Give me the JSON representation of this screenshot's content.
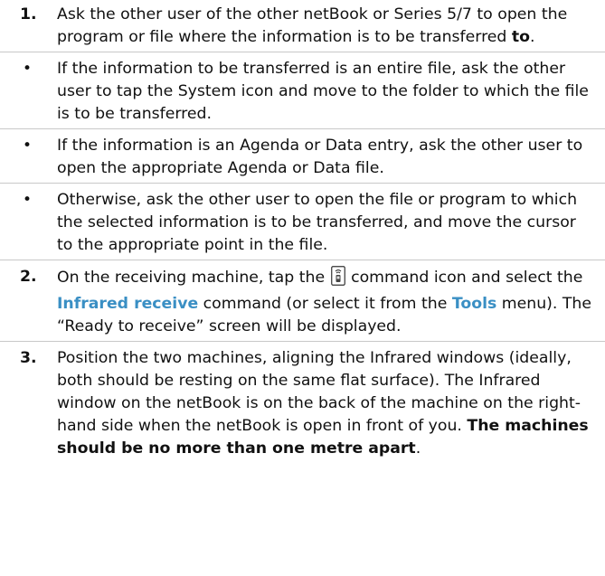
{
  "steps": {
    "step1": {
      "number": "1.",
      "text_a": "Ask the other user of the other netBook or Series 5/7 to open the program or file where the information is to be transferred ",
      "text_b": "to",
      "text_c": "."
    },
    "bullets": [
      {
        "symbol": "•",
        "text": "If the information to be transferred is an entire file, ask the other user to tap the System icon and move to the folder to which the file is to be transferred."
      },
      {
        "symbol": "•",
        "text": "If the information is an Agenda or Data entry, ask the other user to open the appropriate Agenda or Data file."
      },
      {
        "symbol": "•",
        "text": "Otherwise, ask the other user to open the file or program to which the selected information is to be transferred, and move the cursor to the appropriate point in the file."
      }
    ],
    "step2": {
      "number": "2.",
      "text_a": "On the receiving machine, tap the ",
      "icon": "infrared-command-icon",
      "text_b": " command icon and select the ",
      "kw_1": "Infrared receive",
      "text_c": " command (or select it from the ",
      "kw_2": "Tools",
      "text_d": " menu). The “Ready to receive” screen will be displayed."
    },
    "step3": {
      "number": "3.",
      "text_a": "Position the two machines, aligning the Infrared windows (ideally, both should be resting on the same flat surface). The Infrared window on the netBook is on the back of the machine on the right-hand side when the netBook is open in front of you. ",
      "text_b": "The machines should be no more than one metre apart",
      "text_c": "."
    }
  },
  "colors": {
    "keyword": "#3a8fc4",
    "divider": "#c8c8c8",
    "text": "#111111"
  }
}
